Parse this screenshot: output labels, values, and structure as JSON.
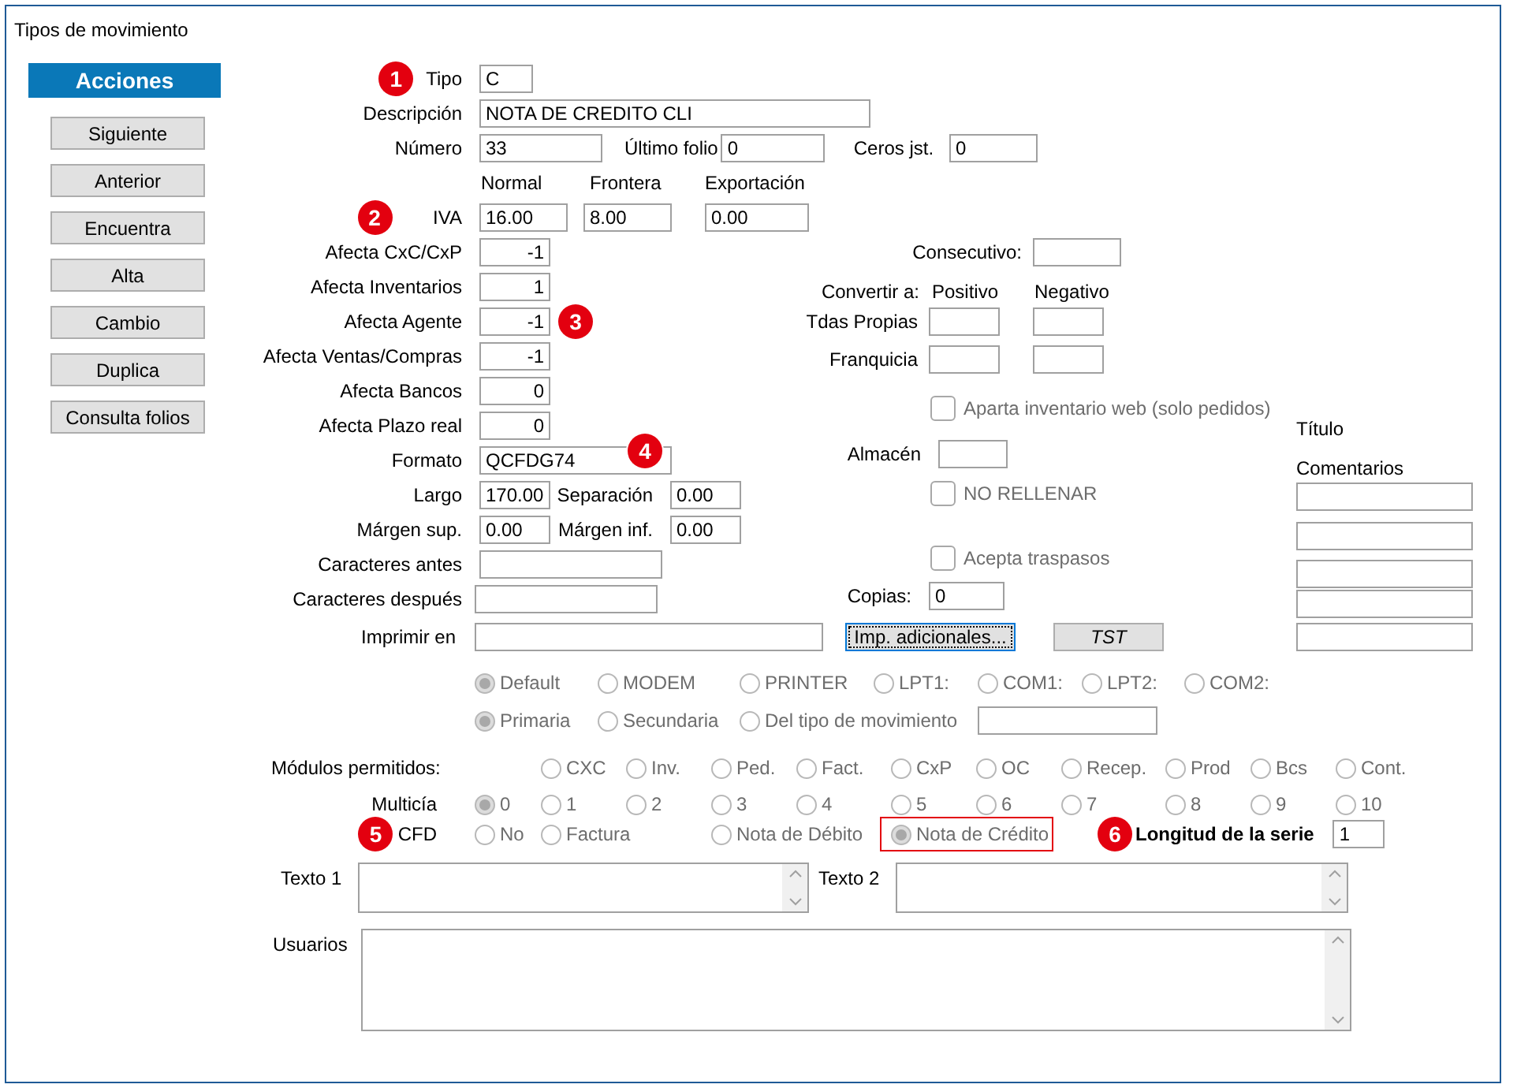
{
  "window": {
    "title": "Tipos de movimiento"
  },
  "actions": {
    "header": "Acciones",
    "buttons": [
      "Siguiente",
      "Anterior",
      "Encuentra",
      "Alta",
      "Cambio",
      "Duplica",
      "Consulta folios"
    ]
  },
  "tipo": {
    "marker": "1",
    "label": "Tipo",
    "value": "C"
  },
  "descripcion": {
    "label": "Descripción",
    "value": "NOTA DE CREDITO CLI"
  },
  "numero": {
    "label": "Número",
    "value": "33"
  },
  "ultimo_folio": {
    "label": "Último folio",
    "value": "0"
  },
  "ceros_jst": {
    "label": "Ceros jst.",
    "value": "0"
  },
  "iva": {
    "marker": "2",
    "label": "IVA",
    "columns": [
      "Normal",
      "Frontera",
      "Exportación"
    ],
    "values": [
      "16.00",
      "8.00",
      "0.00"
    ]
  },
  "afecta": [
    {
      "label": "Afecta CxC/CxP",
      "value": "-1"
    },
    {
      "label": "Afecta Inventarios",
      "value": "1"
    },
    {
      "label": "Afecta Agente",
      "value": "-1",
      "marker": "3"
    },
    {
      "label": "Afecta Ventas/Compras",
      "value": "-1"
    },
    {
      "label": "Afecta Bancos",
      "value": "0"
    },
    {
      "label": "Afecta Plazo real",
      "value": "0"
    }
  ],
  "formato": {
    "label": "Formato",
    "value": "QCFDG74",
    "marker": "4"
  },
  "largo": {
    "label": "Largo",
    "value": "170.00"
  },
  "separacion": {
    "label": "Separación",
    "value": "0.00"
  },
  "margen_sup": {
    "label": "Márgen sup.",
    "value": "0.00"
  },
  "margen_inf": {
    "label": "Márgen inf.",
    "value": "0.00"
  },
  "caracteres_antes": {
    "label": "Caracteres antes"
  },
  "caracteres_despues": {
    "label": "Caracteres después"
  },
  "consecutivo": {
    "label": "Consecutivo:"
  },
  "convertir": {
    "label": "Convertir a:",
    "columns": [
      "Positivo",
      "Negativo"
    ],
    "rows": [
      "Tdas Propias",
      "Franquicia"
    ]
  },
  "checkboxes": [
    {
      "label": "Aparta inventario web (solo pedidos)",
      "checked": false,
      "disabled": true
    },
    {
      "label": "NO RELLENAR",
      "checked": false,
      "disabled": true
    },
    {
      "label": "Acepta traspasos",
      "checked": false,
      "disabled": true
    }
  ],
  "almacen": {
    "label": "Almacén"
  },
  "copias": {
    "label": "Copias:",
    "value": "0"
  },
  "comentarios": {
    "title_label": "Título",
    "label": "Comentarios"
  },
  "imprimir_en": {
    "label": "Imprimir en"
  },
  "print_buttons": [
    {
      "label": "Imp. adicionales...",
      "focused": true
    },
    {
      "label": "TST",
      "focused": false
    }
  ],
  "port": {
    "disabled": true,
    "options": [
      {
        "label": "Default",
        "selected": true
      },
      {
        "label": "MODEM",
        "selected": false
      },
      {
        "label": "PRINTER",
        "selected": false
      },
      {
        "label": "LPT1:",
        "selected": false
      },
      {
        "label": "COM1:",
        "selected": false
      },
      {
        "label": "LPT2:",
        "selected": false
      },
      {
        "label": "COM2:",
        "selected": false
      }
    ]
  },
  "printer": {
    "disabled": true,
    "options": [
      {
        "label": "Primaria",
        "selected": true
      },
      {
        "label": "Secundaria",
        "selected": false
      },
      {
        "label": "Del tipo de movimiento",
        "selected": false
      }
    ]
  },
  "modulos": {
    "label": "Módulos permitidos:",
    "disabled": true,
    "options": [
      {
        "label": "CXC",
        "selected": false
      },
      {
        "label": "Inv.",
        "selected": false
      },
      {
        "label": "Ped.",
        "selected": false
      },
      {
        "label": "Fact.",
        "selected": false
      },
      {
        "label": "CxP",
        "selected": false
      },
      {
        "label": "OC",
        "selected": false
      },
      {
        "label": "Recep.",
        "selected": false
      },
      {
        "label": "Prod",
        "selected": false
      },
      {
        "label": "Bcs",
        "selected": false
      },
      {
        "label": "Cont.",
        "selected": false
      }
    ]
  },
  "multicia": {
    "label": "Multicía",
    "disabled": true,
    "options": [
      {
        "label": "0",
        "selected": true
      },
      {
        "label": "1",
        "selected": false
      },
      {
        "label": "2",
        "selected": false
      },
      {
        "label": "3",
        "selected": false
      },
      {
        "label": "4",
        "selected": false
      },
      {
        "label": "5",
        "selected": false
      },
      {
        "label": "6",
        "selected": false
      },
      {
        "label": "7",
        "selected": false
      },
      {
        "label": "8",
        "selected": false
      },
      {
        "label": "9",
        "selected": false
      },
      {
        "label": "10",
        "selected": false
      }
    ]
  },
  "cfd": {
    "marker": "5",
    "label": "CFD",
    "disabled": true,
    "options": [
      {
        "label": "No",
        "selected": false,
        "highlighted": false
      },
      {
        "label": "Factura",
        "selected": false,
        "highlighted": false
      },
      {
        "label": "Nota de Débito",
        "selected": false,
        "highlighted": false
      },
      {
        "label": "Nota de Crédito",
        "selected": true,
        "highlighted": true
      }
    ]
  },
  "longitud_serie": {
    "marker": "6",
    "label": "Longitud de la serie",
    "value": "1"
  },
  "texto1": {
    "label": "Texto 1"
  },
  "texto2": {
    "label": "Texto 2"
  },
  "usuarios": {
    "label": "Usuarios"
  }
}
